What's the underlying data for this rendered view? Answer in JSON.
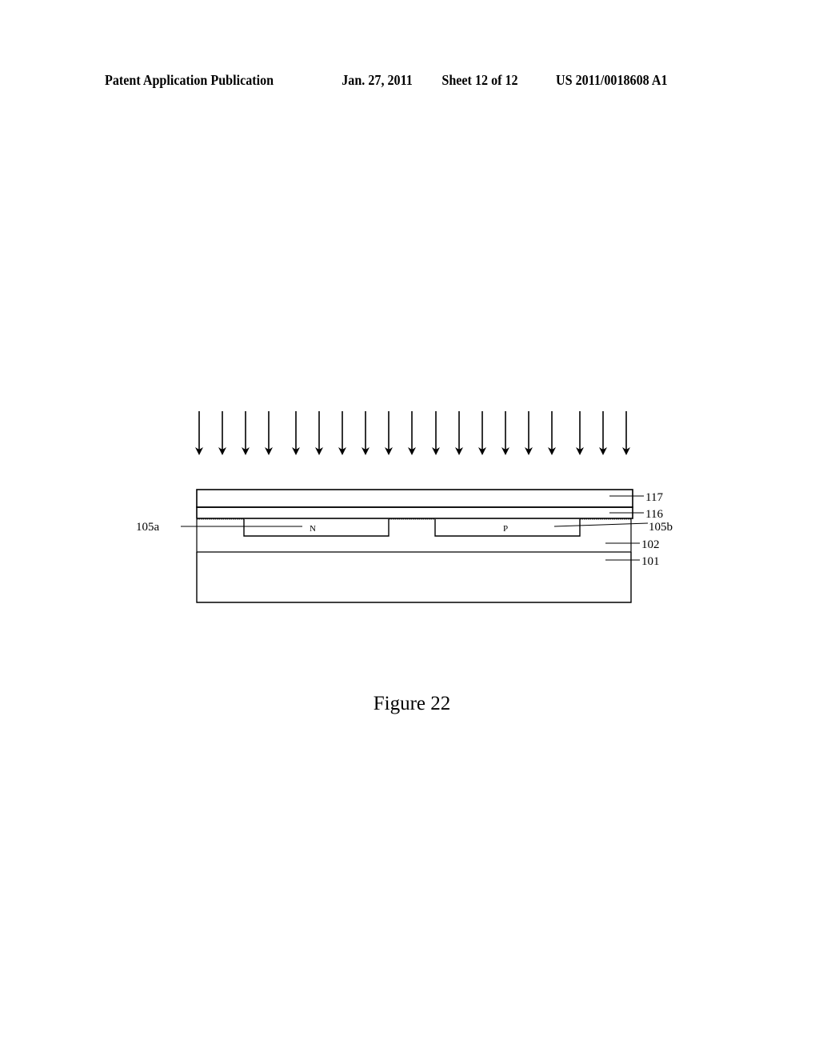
{
  "header": {
    "publication": "Patent Application Publication",
    "date": "Jan. 27, 2011",
    "sheet": "Sheet 12 of 12",
    "number": "US 2011/0018608 A1"
  },
  "figure": {
    "caption": "Figure 22",
    "arrow_count": 19,
    "arrow_direction": "down",
    "layers": [
      {
        "id": "117",
        "label": "117"
      },
      {
        "id": "116",
        "label": "116"
      },
      {
        "id": "102",
        "label": "102"
      },
      {
        "id": "101",
        "label": "101"
      }
    ],
    "regions": [
      {
        "id": "105a",
        "label": "105a",
        "type_label": "N"
      },
      {
        "id": "105b",
        "label": "105b",
        "type_label": "P"
      }
    ]
  }
}
